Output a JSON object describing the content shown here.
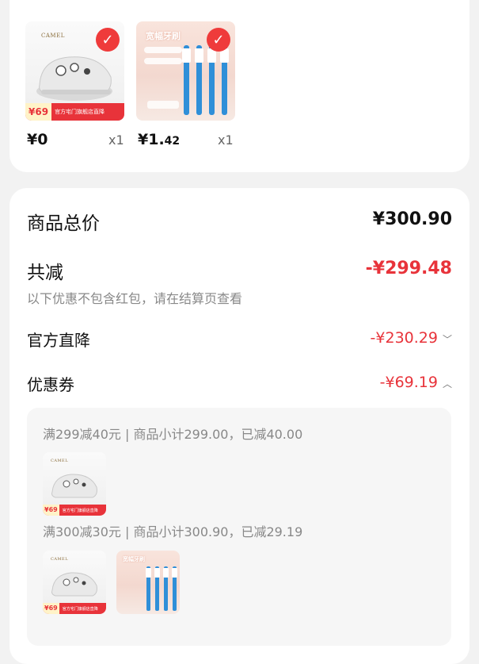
{
  "top_items": [
    {
      "type": "shoe",
      "brand": "CAMEL",
      "promo_price": "¥69",
      "promo_text": "官方宅门旗舰店直降",
      "price": "¥0",
      "qty": "x1"
    },
    {
      "type": "toothbrush",
      "overlay_title": "宽幅牙刷",
      "price_main": "¥1.",
      "price_cents": "42",
      "qty": "x1"
    }
  ],
  "summary": {
    "total_label": "商品总价",
    "total_value": "¥300.90",
    "discount_label": "共减",
    "discount_value": "-¥299.48",
    "discount_note": "以下优惠不包含红包，请在结算页查看",
    "official_label": "官方直降",
    "official_value": "-¥230.29",
    "coupon_label": "优惠券",
    "coupon_value": "-¥69.19"
  },
  "coupons": [
    {
      "rule": "满299减40元 | 商品小计299.00，已减40.00"
    },
    {
      "rule": "满300减30元 | 商品小计300.90，已减29.19"
    }
  ],
  "colors": {
    "accent_red": "#e8333a",
    "check_red": "#ef3b3b"
  },
  "icons": {
    "selected": "check-circle-icon",
    "expand": "chevron-down-icon",
    "collapse": "chevron-up-icon"
  }
}
